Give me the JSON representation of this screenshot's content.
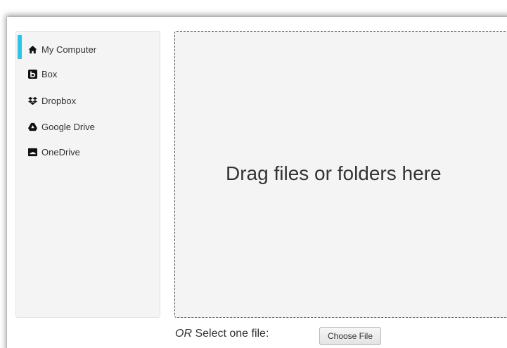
{
  "sidebar": {
    "accent_color": "#2ec4e6",
    "items": [
      {
        "label": "My Computer",
        "icon": "home-icon",
        "active": true
      },
      {
        "label": "Box",
        "icon": "box-icon",
        "active": false
      },
      {
        "label": "Dropbox",
        "icon": "dropbox-icon",
        "active": false
      },
      {
        "label": "Google Drive",
        "icon": "google-drive-icon",
        "active": false
      },
      {
        "label": "OneDrive",
        "icon": "onedrive-icon",
        "active": false
      }
    ]
  },
  "dropzone": {
    "text": "Drag files or folders here"
  },
  "select": {
    "or_label": "OR",
    "label": " Select one file:",
    "button_label": "Choose File"
  }
}
